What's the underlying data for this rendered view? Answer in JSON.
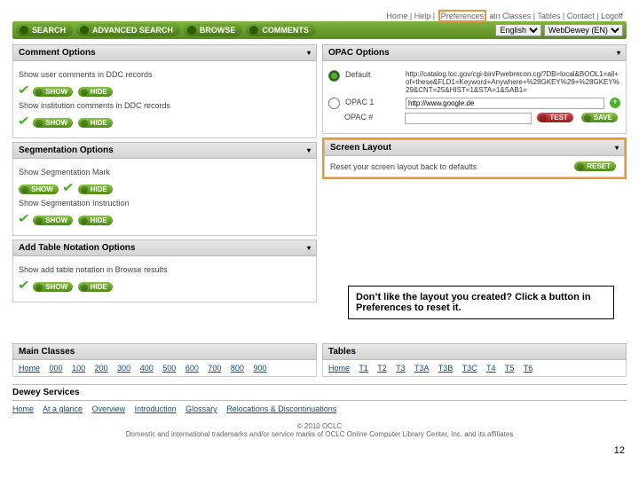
{
  "topbar": {
    "home": "Home",
    "help": "Help",
    "preferences": "Preferences",
    "mainclasses": "ain Classes",
    "tables": "Tables",
    "contact": "Contact",
    "logoff": "Logoff"
  },
  "nav": {
    "search": "SEARCH",
    "advanced": "ADVANCED SEARCH",
    "browse": "BROWSE",
    "comments": "COMMENTS",
    "lang": "English",
    "product": "WebDewey (EN)"
  },
  "commentOptions": {
    "title": "Comment Options",
    "line1": "Show user comments in DDC records",
    "line2": "Show institution comments in DDC records",
    "show": "SHOW",
    "hide": "HIDE"
  },
  "segmentation": {
    "title": "Segmentation Options",
    "line1": "Show Segmentation Mark",
    "line2": "Show Segmentation Instruction",
    "show": "SHOW",
    "hide": "HIDE"
  },
  "tableNotation": {
    "title": "Add Table Notation Options",
    "line1": "Show add table notation in Browse results",
    "show": "SHOW",
    "hide": "HIDE"
  },
  "opac": {
    "title": "OPAC Options",
    "defaultLabel": "Default",
    "defaultUrl": "http://catalog.loc.gov/cgi-bin/Pwebrecon.cgi?DB=local&BOOL1=all+of+these&FLD1=Keyword+Anywhere+%28GKEY%29+%28GKEY%29&CNT=25&HIST=1&STA=1&SAB1=",
    "opac1Label": "OPAC 1",
    "opac1Value": "http://www.google.de",
    "opacNLabel": "OPAC #",
    "test": "TEST",
    "save": "SAVE"
  },
  "screenLayout": {
    "title": "Screen Layout",
    "text": "Reset your screen layout back to defaults",
    "reset": "RESET"
  },
  "callout": "Don’t like the layout you created?  Click a button in Preferences to reset it.",
  "mainClasses": {
    "title": "Main Classes",
    "home": "Home",
    "items": [
      "000",
      "100",
      "200",
      "300",
      "400",
      "500",
      "600",
      "700",
      "800",
      "900"
    ]
  },
  "tables": {
    "title": "Tables",
    "home": "Home",
    "items": [
      "T1",
      "T2",
      "T3",
      "T3A",
      "T3B",
      "T3C",
      "T4",
      "T5",
      "T6"
    ]
  },
  "dewey": {
    "title": "Dewey Services",
    "links": [
      "Home",
      "At a glance",
      "Overview",
      "Introduction",
      "Glossary",
      "Relocations & Discontinuations"
    ]
  },
  "footer": {
    "copy": "© 2010 OCLC",
    "legal": "Domestic and international trademarks and/or service marks of OCLC Online Computer Library Center, Inc. and its affiliates"
  },
  "pagenum": "12"
}
